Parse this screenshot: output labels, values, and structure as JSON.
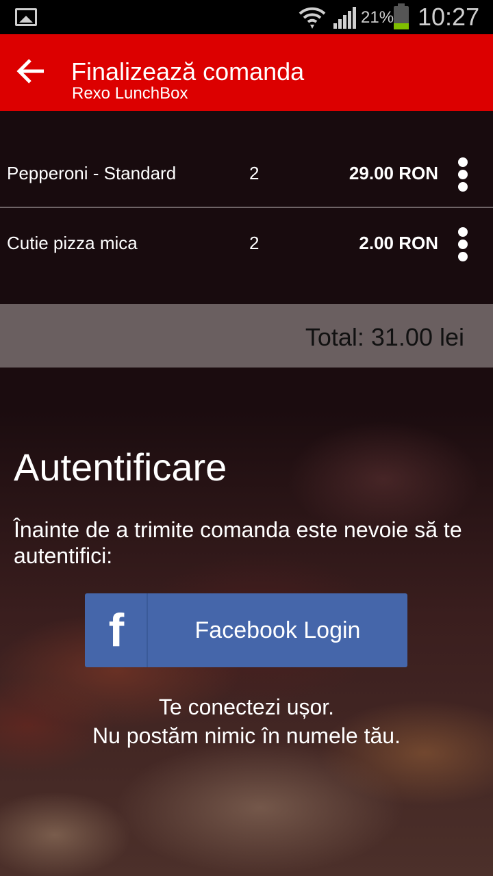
{
  "status_bar": {
    "left_icon": "image-icon",
    "battery_percent": "21%",
    "time": "10:27"
  },
  "action_bar": {
    "back_icon": "arrow-left-icon",
    "title": "Finalizează comanda",
    "subtitle": "Rexo LunchBox",
    "color": "#dc0000"
  },
  "order": {
    "items": [
      {
        "name": "Pepperoni - Standard",
        "qty": "2",
        "price": "29.00 RON"
      },
      {
        "name": "Cutie pizza mica",
        "qty": "2",
        "price": "2.00 RON"
      }
    ],
    "total": "Total: 31.00 lei"
  },
  "auth": {
    "title": "Autentificare",
    "text": "Înainte de a trimite comanda este nevoie să te autentifici:",
    "facebook_button": "Facebook Login",
    "facebook_color": "#4566aa",
    "note_line1": "Te conectezi ușor.",
    "note_line2": "Nu postăm nimic în numele tău."
  }
}
